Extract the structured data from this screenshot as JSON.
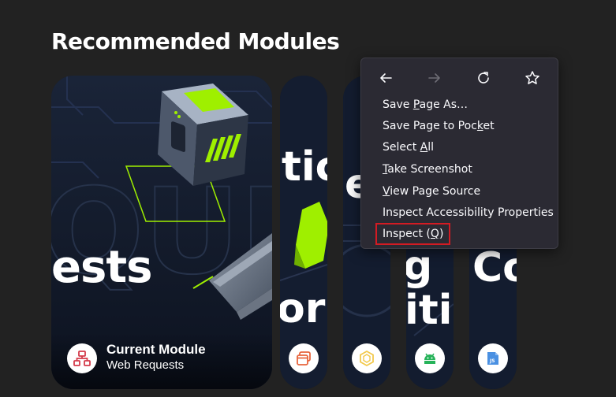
{
  "page": {
    "section_title": "Recommended Modules"
  },
  "cards": {
    "main": {
      "big_text": "ests",
      "label": "Current Module",
      "module_name": "Web Requests",
      "icon": "network-icon"
    },
    "narrow": [
      {
        "big_text_top": "tic",
        "big_text_bottom": "or",
        "icon": "browser-window-icon"
      },
      {
        "big_text_top": "e",
        "big_text_bottom": "",
        "icon": "hexagon-icon"
      },
      {
        "big_text_top": "g",
        "big_text_bottom": "iti",
        "icon": "android-icon"
      },
      {
        "big_text_top": "",
        "big_text_bottom": "Co",
        "icon": "javascript-icon"
      }
    ]
  },
  "context_menu": {
    "nav": {
      "back_icon": "back-arrow-icon",
      "forward_icon": "forward-arrow-icon",
      "reload_icon": "reload-icon",
      "bookmark_icon": "star-icon"
    },
    "items": [
      {
        "label": "Save Page As…",
        "accesskey": "P"
      },
      {
        "label": "Save Page to Pocket",
        "accesskey": "k"
      },
      {
        "label": "Select All",
        "accesskey": "A"
      },
      {
        "label": "Take Screenshot",
        "accesskey": "T"
      },
      {
        "label": "View Page Source",
        "accesskey": "V"
      },
      {
        "label": "Inspect Accessibility Properties",
        "accesskey": ""
      },
      {
        "label": "Inspect (Q)",
        "accesskey": "Q"
      }
    ]
  },
  "colors": {
    "background": "#222222",
    "menu_bg": "#2b2a33",
    "accent_green": "#9fef00",
    "highlight_red": "#d31b23"
  }
}
